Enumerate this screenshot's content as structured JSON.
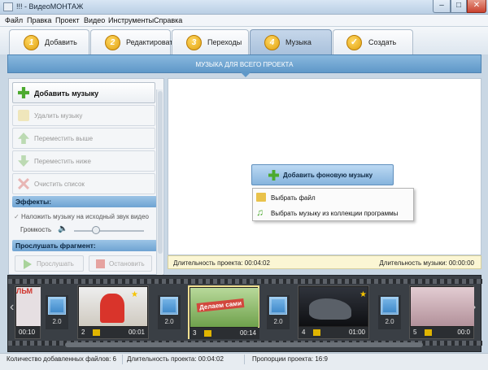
{
  "window": {
    "title": "!!! - ВидеоМОНТАЖ",
    "min": "–",
    "max": "□",
    "close": "✕"
  },
  "menu": [
    "Файл",
    "Правка",
    "Проект",
    "Видео",
    "Инструменты",
    "Справка"
  ],
  "tabs": [
    {
      "num": "1",
      "label": "Добавить"
    },
    {
      "num": "2",
      "label": "Редактировать"
    },
    {
      "num": "3",
      "label": "Переходы"
    },
    {
      "num": "4",
      "label": "Музыка",
      "active": true
    },
    {
      "num": "✓",
      "label": "Создать"
    }
  ],
  "section_title": "МУЗЫКА ДЛЯ ВСЕГО ПРОЕКТА",
  "left": {
    "add_music": "Добавить музыку",
    "delete_music": "Удалить музыку",
    "move_up": "Переместить выше",
    "move_down": "Переместить ниже",
    "clear_list": "Очистить список",
    "effects_header": "Эффекты:",
    "overlay_checkbox": "Наложить музыку на исходный звук видео",
    "volume_label": "Громкость",
    "listen_header": "Прослушать фрагмент:",
    "play_btn": "Прослушать",
    "stop_btn": "Остановить"
  },
  "right": {
    "add_bg_music": "Добавить фоновую музыку",
    "menu_choose_file": "Выбрать файл",
    "menu_choose_collection": "Выбрать музыку из коллекции программы",
    "project_duration": "Длительность проекта: 00:04:02",
    "music_duration": "Длительность музыки: 00:00:00"
  },
  "timeline": {
    "partial_left": {
      "time": "00:10"
    },
    "clips": [
      {
        "num": "2",
        "time": "00:01",
        "color": "#d7d2c4"
      },
      {
        "num": "3",
        "time": "00:14",
        "color": "#8cbf6a",
        "selected": true,
        "caption": "Делаем сами"
      },
      {
        "num": "4",
        "time": "01:00",
        "color": "#1a1c22"
      },
      {
        "num": "5",
        "time": "00:0",
        "color": "#c9a9b2"
      }
    ],
    "transitions": [
      "2.0",
      "2.0",
      "2.0",
      "2.0",
      "2.0"
    ],
    "partial_caption": "ЛЬМ"
  },
  "status": {
    "files": "Количество добавленных файлов: 6",
    "duration": "Длительность проекта: 00:04:02",
    "ratio": "Пропорции проекта: 16:9"
  }
}
